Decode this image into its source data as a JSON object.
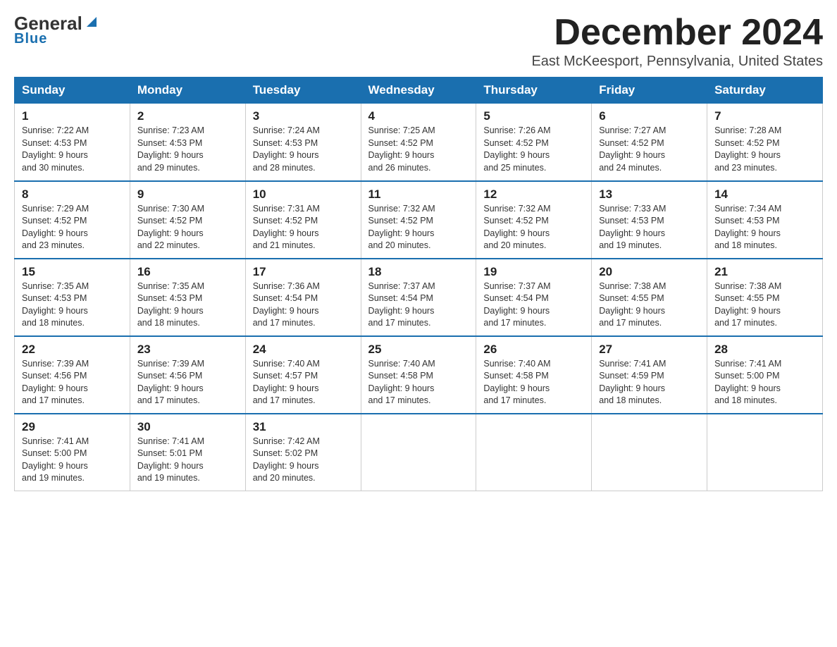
{
  "header": {
    "logo_general": "General",
    "logo_blue": "Blue",
    "month_title": "December 2024",
    "location": "East McKeesport, Pennsylvania, United States"
  },
  "days_of_week": [
    "Sunday",
    "Monday",
    "Tuesday",
    "Wednesday",
    "Thursday",
    "Friday",
    "Saturday"
  ],
  "weeks": [
    [
      {
        "day": "1",
        "sunrise": "7:22 AM",
        "sunset": "4:53 PM",
        "daylight": "9 hours and 30 minutes."
      },
      {
        "day": "2",
        "sunrise": "7:23 AM",
        "sunset": "4:53 PM",
        "daylight": "9 hours and 29 minutes."
      },
      {
        "day": "3",
        "sunrise": "7:24 AM",
        "sunset": "4:53 PM",
        "daylight": "9 hours and 28 minutes."
      },
      {
        "day": "4",
        "sunrise": "7:25 AM",
        "sunset": "4:52 PM",
        "daylight": "9 hours and 26 minutes."
      },
      {
        "day": "5",
        "sunrise": "7:26 AM",
        "sunset": "4:52 PM",
        "daylight": "9 hours and 25 minutes."
      },
      {
        "day": "6",
        "sunrise": "7:27 AM",
        "sunset": "4:52 PM",
        "daylight": "9 hours and 24 minutes."
      },
      {
        "day": "7",
        "sunrise": "7:28 AM",
        "sunset": "4:52 PM",
        "daylight": "9 hours and 23 minutes."
      }
    ],
    [
      {
        "day": "8",
        "sunrise": "7:29 AM",
        "sunset": "4:52 PM",
        "daylight": "9 hours and 23 minutes."
      },
      {
        "day": "9",
        "sunrise": "7:30 AM",
        "sunset": "4:52 PM",
        "daylight": "9 hours and 22 minutes."
      },
      {
        "day": "10",
        "sunrise": "7:31 AM",
        "sunset": "4:52 PM",
        "daylight": "9 hours and 21 minutes."
      },
      {
        "day": "11",
        "sunrise": "7:32 AM",
        "sunset": "4:52 PM",
        "daylight": "9 hours and 20 minutes."
      },
      {
        "day": "12",
        "sunrise": "7:32 AM",
        "sunset": "4:52 PM",
        "daylight": "9 hours and 20 minutes."
      },
      {
        "day": "13",
        "sunrise": "7:33 AM",
        "sunset": "4:53 PM",
        "daylight": "9 hours and 19 minutes."
      },
      {
        "day": "14",
        "sunrise": "7:34 AM",
        "sunset": "4:53 PM",
        "daylight": "9 hours and 18 minutes."
      }
    ],
    [
      {
        "day": "15",
        "sunrise": "7:35 AM",
        "sunset": "4:53 PM",
        "daylight": "9 hours and 18 minutes."
      },
      {
        "day": "16",
        "sunrise": "7:35 AM",
        "sunset": "4:53 PM",
        "daylight": "9 hours and 18 minutes."
      },
      {
        "day": "17",
        "sunrise": "7:36 AM",
        "sunset": "4:54 PM",
        "daylight": "9 hours and 17 minutes."
      },
      {
        "day": "18",
        "sunrise": "7:37 AM",
        "sunset": "4:54 PM",
        "daylight": "9 hours and 17 minutes."
      },
      {
        "day": "19",
        "sunrise": "7:37 AM",
        "sunset": "4:54 PM",
        "daylight": "9 hours and 17 minutes."
      },
      {
        "day": "20",
        "sunrise": "7:38 AM",
        "sunset": "4:55 PM",
        "daylight": "9 hours and 17 minutes."
      },
      {
        "day": "21",
        "sunrise": "7:38 AM",
        "sunset": "4:55 PM",
        "daylight": "9 hours and 17 minutes."
      }
    ],
    [
      {
        "day": "22",
        "sunrise": "7:39 AM",
        "sunset": "4:56 PM",
        "daylight": "9 hours and 17 minutes."
      },
      {
        "day": "23",
        "sunrise": "7:39 AM",
        "sunset": "4:56 PM",
        "daylight": "9 hours and 17 minutes."
      },
      {
        "day": "24",
        "sunrise": "7:40 AM",
        "sunset": "4:57 PM",
        "daylight": "9 hours and 17 minutes."
      },
      {
        "day": "25",
        "sunrise": "7:40 AM",
        "sunset": "4:58 PM",
        "daylight": "9 hours and 17 minutes."
      },
      {
        "day": "26",
        "sunrise": "7:40 AM",
        "sunset": "4:58 PM",
        "daylight": "9 hours and 17 minutes."
      },
      {
        "day": "27",
        "sunrise": "7:41 AM",
        "sunset": "4:59 PM",
        "daylight": "9 hours and 18 minutes."
      },
      {
        "day": "28",
        "sunrise": "7:41 AM",
        "sunset": "5:00 PM",
        "daylight": "9 hours and 18 minutes."
      }
    ],
    [
      {
        "day": "29",
        "sunrise": "7:41 AM",
        "sunset": "5:00 PM",
        "daylight": "9 hours and 19 minutes."
      },
      {
        "day": "30",
        "sunrise": "7:41 AM",
        "sunset": "5:01 PM",
        "daylight": "9 hours and 19 minutes."
      },
      {
        "day": "31",
        "sunrise": "7:42 AM",
        "sunset": "5:02 PM",
        "daylight": "9 hours and 20 minutes."
      },
      null,
      null,
      null,
      null
    ]
  ],
  "labels": {
    "sunrise": "Sunrise:",
    "sunset": "Sunset:",
    "daylight": "Daylight:"
  }
}
